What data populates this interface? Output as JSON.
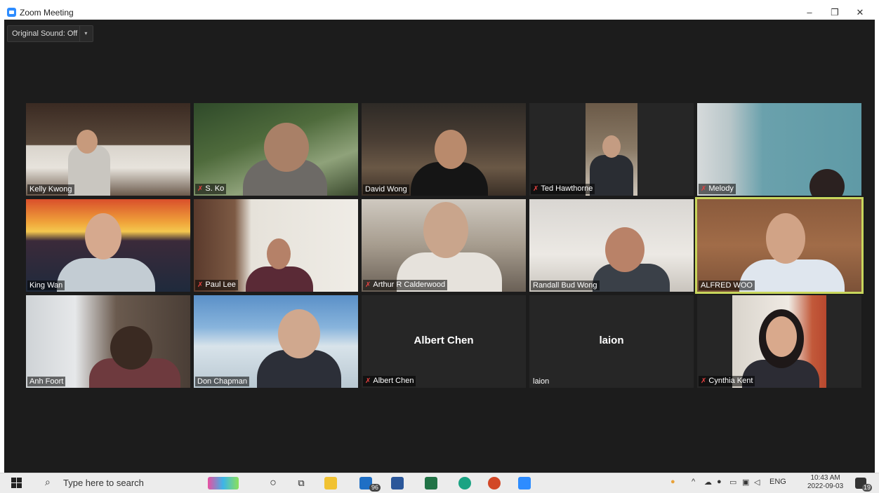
{
  "window": {
    "title": "Zoom Meeting",
    "minimize": "–",
    "restore": "❐",
    "close": "✕"
  },
  "toolbar": {
    "original_sound": "Original Sound: Off",
    "caret": "▾"
  },
  "participants": [
    {
      "name": "Kelly Kwong",
      "muted": false
    },
    {
      "name": "S. Ko",
      "muted": true
    },
    {
      "name": "David Wong",
      "muted": false
    },
    {
      "name": "Ted Hawthorne",
      "muted": true
    },
    {
      "name": "Melody",
      "muted": true
    },
    {
      "name": "King Wan",
      "muted": false
    },
    {
      "name": "Paul Lee",
      "muted": true
    },
    {
      "name": "Arthur R Calderwood",
      "muted": true
    },
    {
      "name": "Randall Bud Wong",
      "muted": false
    },
    {
      "name": "ALFRED WOO",
      "muted": false,
      "speaking": true
    },
    {
      "name": "Anh Foort",
      "muted": false
    },
    {
      "name": "Don Chapman",
      "muted": false
    },
    {
      "name": "Albert Chen",
      "muted": true,
      "video_off": true
    },
    {
      "name": "laion",
      "muted": false,
      "video_off": true
    },
    {
      "name": "Cynthia Kent",
      "muted": true
    }
  ],
  "taskbar": {
    "search_placeholder": "Type here to search",
    "search_icon": "search-icon",
    "mail_badge": "96",
    "language": "ENG",
    "time": "10:43 AM",
    "date": "2022-09-03",
    "notification_count": "19"
  }
}
